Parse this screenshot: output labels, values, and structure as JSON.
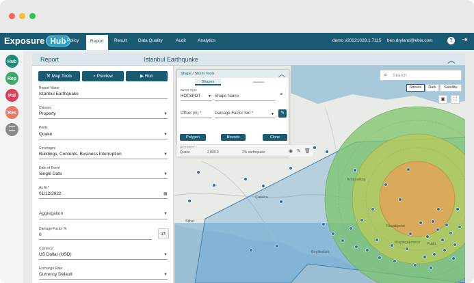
{
  "nav": {
    "logo_text": "Exposure",
    "logo_hub": "Hub",
    "items": [
      {
        "label": "Policy",
        "active": false
      },
      {
        "label": "Report",
        "active": true
      },
      {
        "label": "Result",
        "active": false
      },
      {
        "label": "Data Quality",
        "active": false
      },
      {
        "label": "Audit",
        "active": false
      },
      {
        "label": "Analytics",
        "active": false
      }
    ],
    "version": "demo v20221028.1.7115",
    "user": "ben.dryland@ebix.com",
    "help_glyph": "?",
    "logout_glyph": "⇥"
  },
  "rail": [
    {
      "label": "Hub",
      "color": "#1b8a7a"
    },
    {
      "label": "Rep",
      "color": "#3aa86b"
    },
    {
      "label": "Pol",
      "color": "#d6445a"
    },
    {
      "label": "Res",
      "color": "#e8776a"
    },
    {
      "label": "",
      "color": "#8a8a8a"
    }
  ],
  "panel": {
    "title": "Report",
    "report_name": "Istanbul Earthquake"
  },
  "toolbar": {
    "map_tools": "Map Tools",
    "preview": "Preview",
    "run": "Run"
  },
  "form": {
    "report_name_label": "Report Name",
    "report_name_value": "Istanbul Earthquake",
    "classes_label": "Classes",
    "classes_value": "Property",
    "perils_label": "Perils",
    "perils_value": "Quake",
    "coverages_label": "Coverages",
    "coverages_value": "Buildings, Contents, Business Interruption",
    "date_of_event_label": "Date of Event",
    "date_of_event_value": "Single Date",
    "as_at_label": "As At *",
    "as_at_value": "01/12/2022",
    "aggregation_label": "Aggregation",
    "damage_factor_label": "Damage Factor %",
    "damage_factor_value": "0",
    "currency_label": "Currency",
    "currency_value": "US Dollar (USD)",
    "exchange_rate_label": "Exchange Rate",
    "exchange_rate_value": "Currency Default"
  },
  "tools": {
    "title": "Shape / Storm Tools",
    "tab_shapes": "Shapes",
    "event_type_label": "Event Type",
    "event_type_value": "HOTSPOT",
    "shape_name_placeholder": "Shape Name",
    "offset_label": "Offset (m) *",
    "damage_factor_set_label": "Damage Factor Set *",
    "polygon": "Polygon",
    "bounds": "Bounds",
    "clone": "Clone"
  },
  "shape_row": {
    "col1_sub": "HOTSPOT",
    "col1_val": "Quake",
    "col2_val": "2,000.0",
    "col3_val": "2% earthquake"
  },
  "map": {
    "search_placeholder": "Search",
    "basemaps": [
      "Streets",
      "Dark",
      "Satellite"
    ],
    "places": [
      "Silivri",
      "Çatalca",
      "Arnavutköy",
      "Başakşehir",
      "Beylikdüzü",
      "Küçükçekmece",
      "Fatih"
    ],
    "zone_colors": {
      "outer": "#7cc46a",
      "middle": "#b6c95c",
      "inner": "#e0a458"
    },
    "polygon_color": "#5a9fd4"
  }
}
